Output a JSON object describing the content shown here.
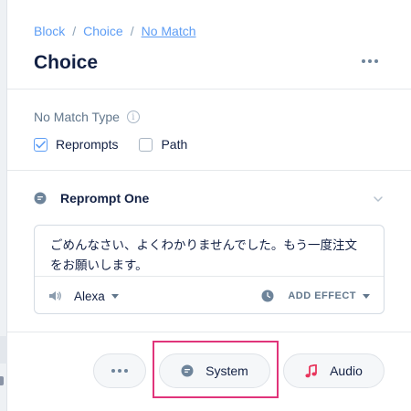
{
  "breadcrumb": {
    "items": [
      "Block",
      "Choice",
      "No Match"
    ],
    "separator": "/"
  },
  "title": "Choice",
  "no_match": {
    "label": "No Match Type",
    "options": [
      {
        "label": "Reprompts",
        "checked": true
      },
      {
        "label": "Path",
        "checked": false
      }
    ]
  },
  "reprompt": {
    "title": "Reprompt One",
    "text": "ごめんなさい、よくわかりませんでした。もう一度注文をお願いします。",
    "voice": "Alexa",
    "effect_label": "ADD EFFECT"
  },
  "buttons": {
    "system": "System",
    "audio": "Audio"
  },
  "colors": {
    "accent": "#5d9df5",
    "highlight": "#e0347a",
    "audio_icon": "#e8365d"
  }
}
